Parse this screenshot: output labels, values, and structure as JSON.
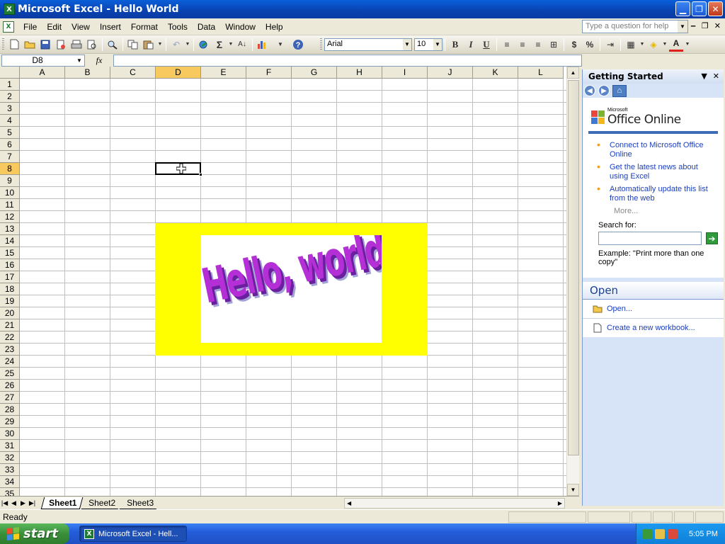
{
  "window": {
    "title": "Microsoft Excel - Hello World",
    "app_icon": "X"
  },
  "menu": {
    "items": [
      "File",
      "Edit",
      "View",
      "Insert",
      "Format",
      "Tools",
      "Data",
      "Window",
      "Help"
    ],
    "help_placeholder": "Type a question for help"
  },
  "toolbar": {
    "font_name": "Arial",
    "font_size": "10",
    "sum_symbol": "Σ",
    "sort_label": "A↓",
    "currency": "$",
    "percent": "%",
    "bold": "B",
    "italic": "I",
    "underline": "U",
    "font_color_letter": "A"
  },
  "formula_bar": {
    "name_box": "D8",
    "fx": "fx",
    "formula": ""
  },
  "sheet": {
    "columns": [
      "A",
      "B",
      "C",
      "D",
      "E",
      "F",
      "G",
      "H",
      "I",
      "J",
      "K",
      "L"
    ],
    "rows": [
      "1",
      "2",
      "3",
      "4",
      "5",
      "6",
      "7",
      "8",
      "9",
      "10",
      "11",
      "12",
      "13",
      "14",
      "15",
      "16",
      "17",
      "18",
      "19",
      "20",
      "21",
      "22",
      "23",
      "24",
      "25",
      "26",
      "27",
      "28",
      "29",
      "30",
      "31",
      "32",
      "33",
      "34",
      "35"
    ],
    "active_column": "D",
    "active_row": "8",
    "wordart_text": "Hello, world!",
    "tabs": [
      "Sheet1",
      "Sheet2",
      "Sheet3"
    ],
    "active_tab": "Sheet1"
  },
  "status": {
    "text": "Ready"
  },
  "task_pane": {
    "title": "Getting Started",
    "logo_small": "Microsoft",
    "logo_big": "Office Online",
    "links": [
      "Connect to Microsoft Office Online",
      "Get the latest news about using Excel",
      "Automatically update this list from the web"
    ],
    "more": "More...",
    "search_label": "Search for:",
    "example": "Example:  \"Print more than one copy\"",
    "open_section": "Open",
    "open_link": "Open...",
    "new_workbook": "Create a new workbook..."
  },
  "taskbar": {
    "start": "start",
    "task_button": "Microsoft Excel - Hell...",
    "clock": "5:05 PM"
  },
  "colors": {
    "wordart_frame": "#ffff00",
    "wordart_text": "#b42fd6",
    "active_header": "#f7c95e"
  }
}
